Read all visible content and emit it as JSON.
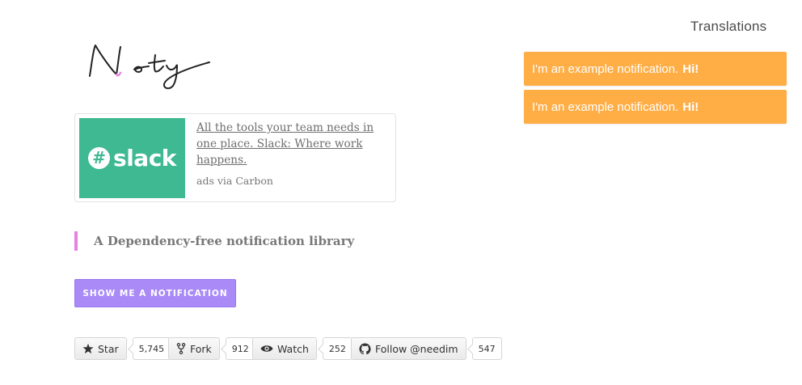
{
  "header": {
    "translations_link": "Translations"
  },
  "logo": {
    "alt": "Noty"
  },
  "ad": {
    "brand": "slack",
    "text": "All the tools your team needs in one place. Slack: Where work happens.",
    "powered_by": "ads via Carbon",
    "brand_color": "#3eb991"
  },
  "tagline": "A Dependency-free notification library",
  "show_button": "SHOW ME A NOTIFICATION",
  "github": {
    "star": {
      "label": "Star",
      "count": "5,745"
    },
    "fork": {
      "label": "Fork",
      "count": "912"
    },
    "watch": {
      "label": "Watch",
      "count": "252"
    },
    "follow": {
      "label": "Follow @needim",
      "count": "547"
    }
  },
  "notifications": [
    {
      "text": "I'm an example notification.",
      "emphasis": "Hi!"
    },
    {
      "text": "I'm an example notification.",
      "emphasis": "Hi!"
    }
  ],
  "colors": {
    "notification_bg": "#ffad45",
    "button_bg": "#a98af6",
    "tagline_accent": "#e583e3"
  },
  "icons": {
    "star": "star-icon",
    "fork": "fork-icon",
    "watch": "eye-icon",
    "follow": "github-icon"
  }
}
